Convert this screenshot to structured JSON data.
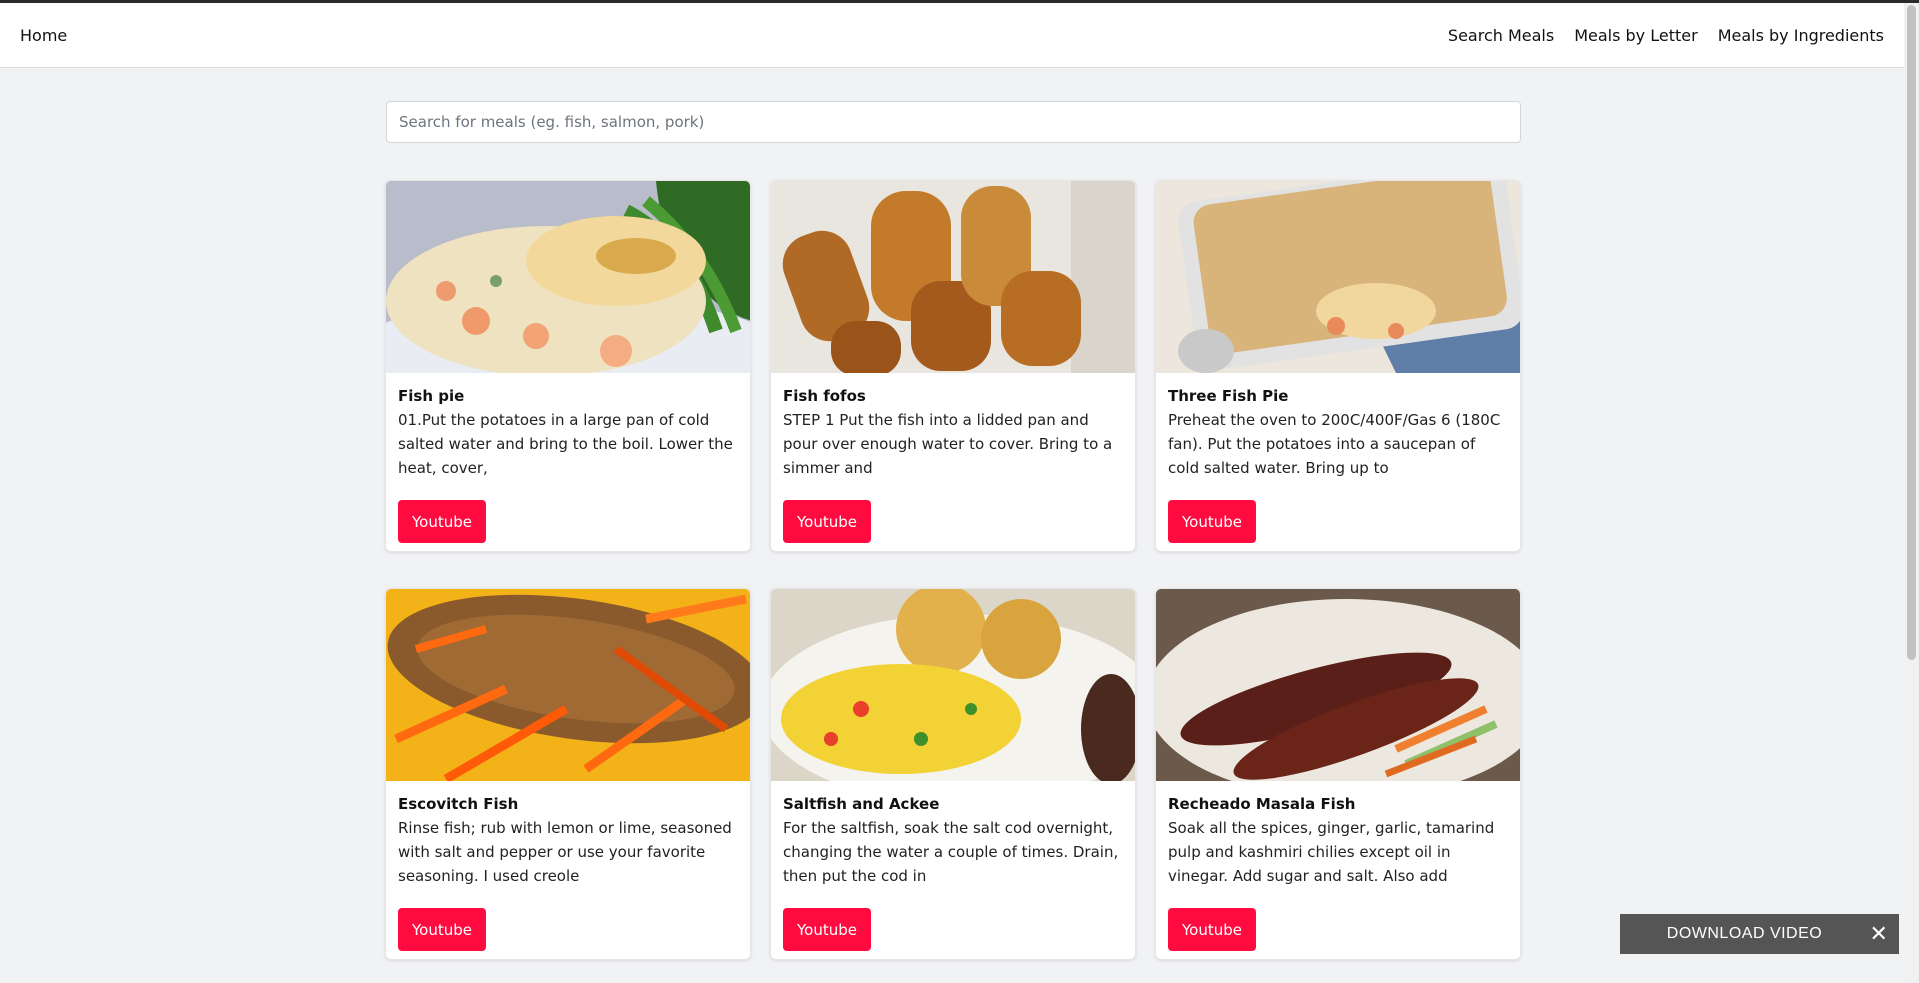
{
  "nav": {
    "home": "Home",
    "links": [
      "Search Meals",
      "Meals by Letter",
      "Meals by Ingredients"
    ]
  },
  "search": {
    "placeholder": "Search for meals (eg. fish, salmon, pork)",
    "value": ""
  },
  "meals": [
    {
      "title": "Fish pie",
      "text": "01.Put the potatoes in a large pan of cold salted water and bring to the boil. Lower the heat, cover,",
      "button": "Youtube",
      "image": "fish-pie-photo"
    },
    {
      "title": "Fish fofos",
      "text": "STEP 1 Put the fish into a lidded pan and pour over enough water to cover. Bring to a simmer and",
      "button": "Youtube",
      "image": "fish-fofos-photo"
    },
    {
      "title": "Three Fish Pie",
      "text": "Preheat the oven to 200C/400F/Gas 6 (180C fan). Put the potatoes into a saucepan of cold salted water. Bring up to",
      "button": "Youtube",
      "image": "three-fish-pie-photo"
    },
    {
      "title": "Escovitch Fish",
      "text": "Rinse fish; rub with lemon or lime, seasoned with salt and pepper or use your favorite seasoning. I used creole",
      "button": "Youtube",
      "image": "escovitch-fish-photo"
    },
    {
      "title": "Saltfish and Ackee",
      "text": "For the saltfish, soak the salt cod overnight, changing the water a couple of times. Drain, then put the cod in",
      "button": "Youtube",
      "image": "saltfish-ackee-photo"
    },
    {
      "title": "Recheado Masala Fish",
      "text": "Soak all the spices, ginger, garlic, tamarind pulp and kashmiri chilies except oil in vinegar. Add sugar and salt. Also add turmeric",
      "button": "Youtube",
      "image": "recheado-masala-fish-photo"
    }
  ],
  "download_widget": {
    "label": "DOWNLOAD VIDEO",
    "close_icon": "close-icon"
  },
  "colors": {
    "accent": "#ff0b40",
    "background": "#f1f2f4"
  }
}
